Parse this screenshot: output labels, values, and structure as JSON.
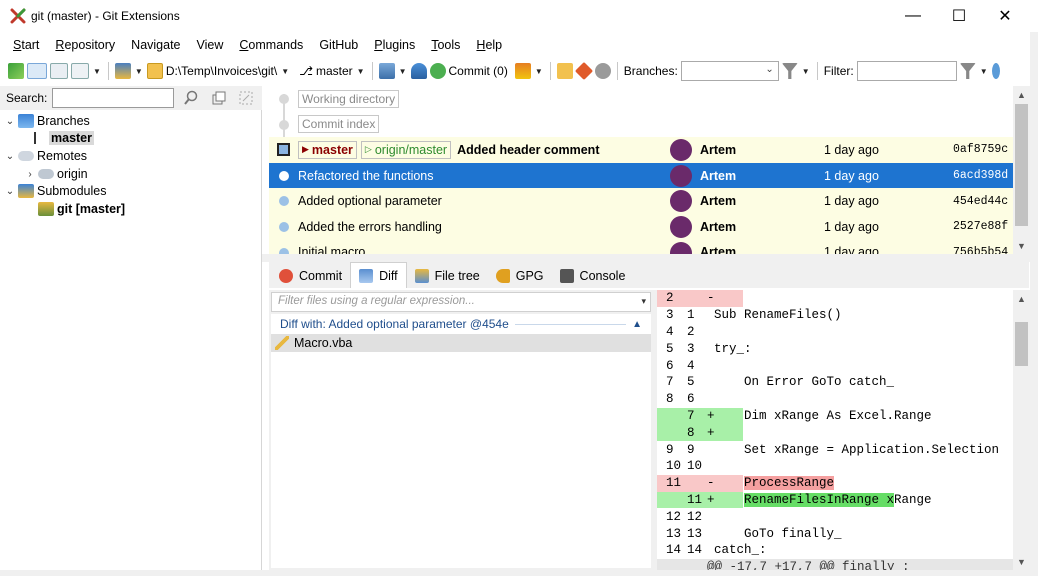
{
  "window": {
    "title": "git (master) - Git Extensions",
    "minimize_glyph": "—",
    "maximize_glyph": "☐",
    "close_glyph": "✕"
  },
  "menu": [
    {
      "label": "Start",
      "ul": "S",
      "rest": "tart"
    },
    {
      "label": "Repository",
      "ul": "R",
      "rest": "epository"
    },
    {
      "label": "Navigate",
      "ul": "",
      "rest": "Navigate"
    },
    {
      "label": "View",
      "ul": "",
      "rest": "View"
    },
    {
      "label": "Commands",
      "ul": "C",
      "rest": "ommands"
    },
    {
      "label": "GitHub",
      "ul": "",
      "rest": "GitHub"
    },
    {
      "label": "Plugins",
      "ul": "P",
      "rest": "lugins"
    },
    {
      "label": "Tools",
      "ul": "T",
      "rest": "ools"
    },
    {
      "label": "Help",
      "ul": "H",
      "rest": "elp"
    }
  ],
  "toolbar": {
    "repo_path": "D:\\Temp\\Invoices\\git\\",
    "branch": "master",
    "commit_label": "Commit (0)",
    "branches_label": "Branches:",
    "filter_label": "Filter:"
  },
  "left": {
    "search_label": "Search:",
    "tree": {
      "branches": "Branches",
      "master": "master",
      "remotes": "Remotes",
      "origin": "origin",
      "submodules": "Submodules",
      "submodule_item": "git [master]"
    }
  },
  "grid": {
    "working_directory": "Working directory",
    "commit_index": "Commit index",
    "rows": [
      {
        "local_branch": "master",
        "remote_branch": "origin/master",
        "subject": "Added header comment",
        "author": "Artem",
        "date": "1 day ago",
        "sha": "0af8759c"
      },
      {
        "subject": "Refactored the functions",
        "author": "Artem",
        "date": "1 day ago",
        "sha": "6acd398d"
      },
      {
        "subject": "Added optional parameter",
        "author": "Artem",
        "date": "1 day ago",
        "sha": "454ed44c"
      },
      {
        "subject": "Added the errors handling",
        "author": "Artem",
        "date": "1 day ago",
        "sha": "2527e88f"
      },
      {
        "subject": "Initial macro",
        "author": "Artem",
        "date": "1 day ago",
        "sha": "756b5b54"
      }
    ]
  },
  "tabs": [
    {
      "label": "Commit",
      "active": false
    },
    {
      "label": "Diff",
      "active": true
    },
    {
      "label": "File tree",
      "active": false
    },
    {
      "label": "GPG",
      "active": false
    },
    {
      "label": "Console",
      "active": false
    }
  ],
  "filelist": {
    "filter_placeholder": "Filter files using a regular expression...",
    "diff_with": "Diff with: Added optional parameter @454e",
    "files": [
      "Macro.vba"
    ]
  },
  "diff_lines": [
    {
      "type": "del",
      "n1": "2",
      "n2": "",
      "mk": "-",
      "code": ""
    },
    {
      "type": "ctx",
      "n1": "3",
      "n2": "1",
      "mk": "",
      "code": "Sub RenameFiles()"
    },
    {
      "type": "ctx",
      "n1": "4",
      "n2": "2",
      "mk": "",
      "code": ""
    },
    {
      "type": "ctx",
      "n1": "5",
      "n2": "3",
      "mk": "",
      "code": "try_:"
    },
    {
      "type": "ctx",
      "n1": "6",
      "n2": "4",
      "mk": "",
      "code": ""
    },
    {
      "type": "ctx",
      "n1": "7",
      "n2": "5",
      "mk": "",
      "code": "    On Error GoTo catch_"
    },
    {
      "type": "ctx",
      "n1": "8",
      "n2": "6",
      "mk": "",
      "code": ""
    },
    {
      "type": "add",
      "n1": "",
      "n2": "7",
      "mk": "+",
      "code": "    Dim xRange As Excel.Range"
    },
    {
      "type": "add",
      "n1": "",
      "n2": "8",
      "mk": "+",
      "code": ""
    },
    {
      "type": "ctx",
      "n1": "9",
      "n2": "9",
      "mk": "",
      "code": "    Set xRange = Application.Selection"
    },
    {
      "type": "ctx",
      "n1": "10",
      "n2": "10",
      "mk": "",
      "code": ""
    },
    {
      "type": "del",
      "n1": "11",
      "n2": "",
      "mk": "-",
      "code": "    ProcessRange",
      "hl": "ProcessRange",
      "tail": ""
    },
    {
      "type": "add",
      "n1": "",
      "n2": "11",
      "mk": "+",
      "code": "    RenameFilesInRange xRange",
      "hl": "RenameFilesInRange x",
      "tail": "Range"
    },
    {
      "type": "ctx",
      "n1": "12",
      "n2": "12",
      "mk": "",
      "code": ""
    },
    {
      "type": "ctx",
      "n1": "13",
      "n2": "13",
      "mk": "",
      "code": "    GoTo finally_"
    },
    {
      "type": "ctx",
      "n1": "14",
      "n2": "14",
      "mk": "",
      "code": "catch_:"
    },
    {
      "type": "hunk",
      "n1": "",
      "n2": "",
      "mk": "",
      "code": "@@ -17,7 +17,7 @@ finally_:"
    }
  ],
  "colors": {
    "selection": "#1e74d0",
    "head_row": "#fdfde3",
    "diff_del": "#f9c8c8",
    "diff_add": "#a8f0a8"
  }
}
